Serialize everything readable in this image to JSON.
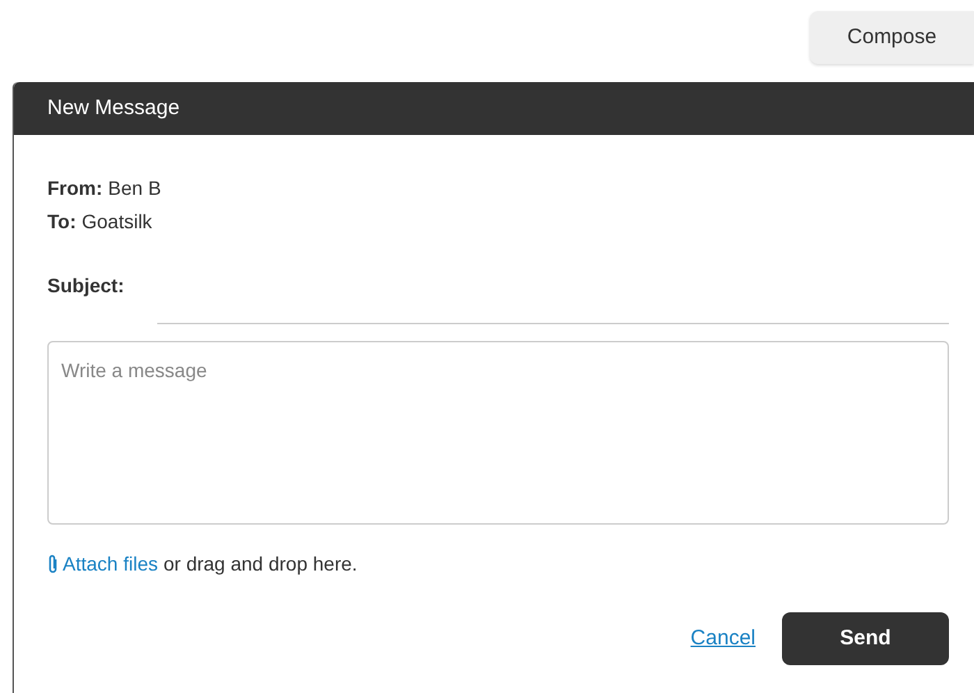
{
  "compose_button": "Compose",
  "dialog": {
    "title": "New Message",
    "fields": [
      {
        "label": "From:",
        "value": "Ben B"
      },
      {
        "label": "To:",
        "value": "Goatsilk"
      }
    ],
    "subject": {
      "label": "Subject:"
    },
    "message": {
      "placeholder": "Write a message"
    },
    "attach": {
      "link": "Attach files",
      "text": "or drag and drop here."
    },
    "cancel": "Cancel",
    "send": "Send"
  }
}
